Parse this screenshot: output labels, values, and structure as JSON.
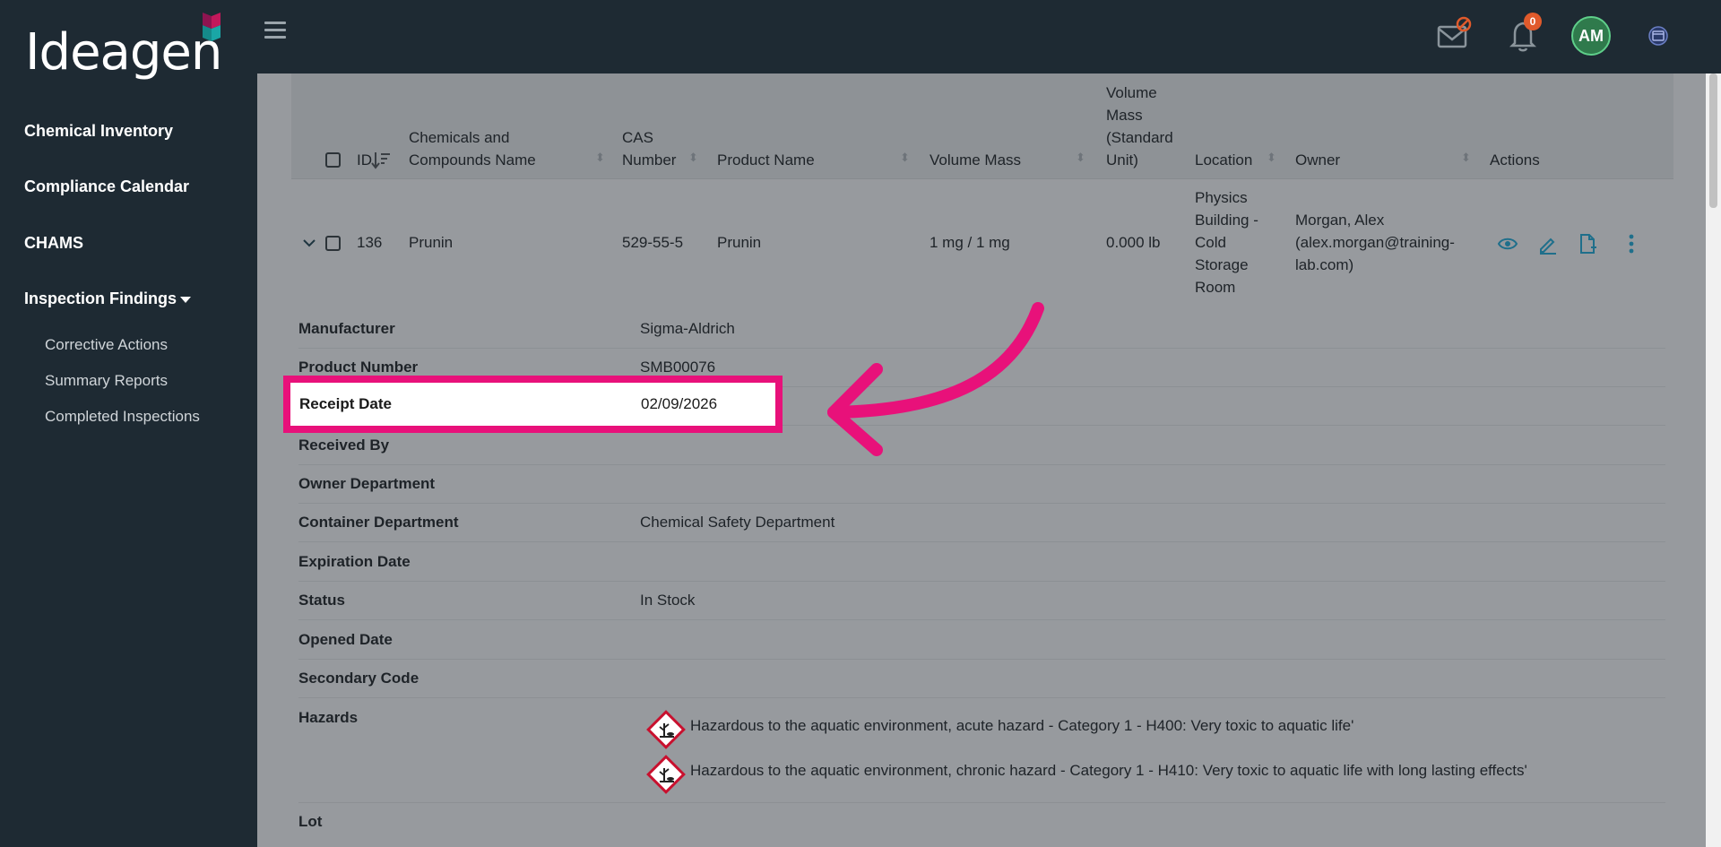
{
  "brand": {
    "logo_text": "Ideagen"
  },
  "sidebar": {
    "items": [
      {
        "label": "Chemical Inventory"
      },
      {
        "label": "Compliance Calendar"
      },
      {
        "label": "CHAMS"
      },
      {
        "label": "Inspection Findings"
      }
    ],
    "subitems": [
      {
        "label": "Corrective Actions"
      },
      {
        "label": "Summary Reports"
      },
      {
        "label": "Completed Inspections"
      }
    ]
  },
  "topbar": {
    "notifications_count": "0",
    "avatar_initials": "AM"
  },
  "table": {
    "headers": {
      "id": "ID",
      "name_line1": "Chemicals and",
      "name_line2": "Compounds Name",
      "cas_line1": "CAS",
      "cas_line2": "Number",
      "product": "Product Name",
      "volume": "Volume Mass",
      "std_line1": "Volume",
      "std_line2": "Mass",
      "std_line3": "(Standard",
      "std_line4": "Unit)",
      "location": "Location",
      "owner": "Owner",
      "actions": "Actions"
    },
    "row": {
      "id": "136",
      "name": "Prunin",
      "cas": "529-55-5",
      "product": "Prunin",
      "volume": "1 mg / 1 mg",
      "std": "0.000 lb",
      "loc_line1": "Physics",
      "loc_line2": "Building -",
      "loc_line3": "Cold",
      "loc_line4": "Storage",
      "loc_line5": "Room",
      "owner_line1": "Morgan, Alex",
      "owner_line2": "(alex.morgan@training-",
      "owner_line3": "lab.com)"
    }
  },
  "details": {
    "manufacturer": {
      "label": "Manufacturer",
      "value": "Sigma-Aldrich"
    },
    "product_number": {
      "label": "Product Number",
      "value": "SMB00076"
    },
    "receipt_date": {
      "label": "Receipt Date",
      "value": "02/09/2026"
    },
    "received_by": {
      "label": "Received By",
      "value": ""
    },
    "owner_department": {
      "label": "Owner Department",
      "value": ""
    },
    "container_department": {
      "label": "Container Department",
      "value": "Chemical Safety Department"
    },
    "expiration_date": {
      "label": "Expiration Date",
      "value": ""
    },
    "status": {
      "label": "Status",
      "value": "In Stock"
    },
    "opened_date": {
      "label": "Opened Date",
      "value": ""
    },
    "secondary_code": {
      "label": "Secondary Code",
      "value": ""
    },
    "hazards": {
      "label": "Hazards",
      "items": [
        "Hazardous to the aquatic environment, acute hazard - Category 1 - H400: Very toxic to aquatic life'",
        "Hazardous to the aquatic environment, chronic hazard - Category 1 - H410: Very toxic to aquatic life with long lasting effects'"
      ]
    },
    "lot": {
      "label": "Lot",
      "value": ""
    }
  },
  "colors": {
    "highlight": "#e8117a",
    "sidebar": "#1e2a33",
    "icon_teal": "#1f6f8b"
  }
}
